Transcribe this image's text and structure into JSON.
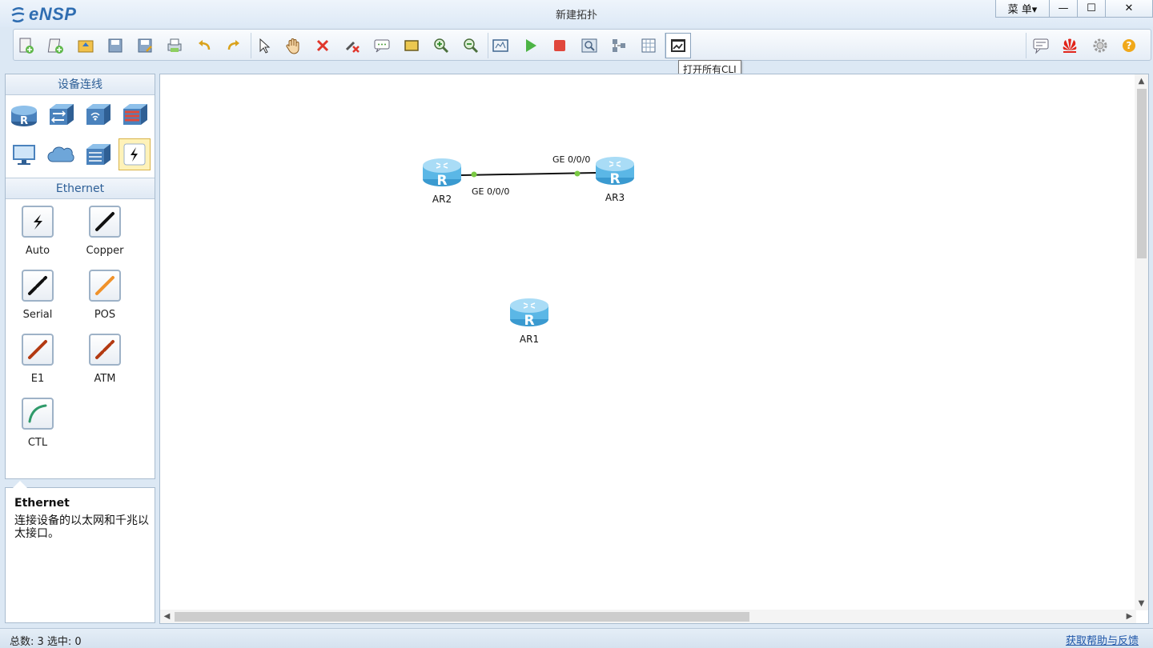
{
  "app": {
    "logo_text": "eNSP",
    "window_title": "新建拓扑",
    "menu_label": "菜 单▾",
    "min_glyph": "—",
    "max_glyph": "☐",
    "close_glyph": "✕"
  },
  "toolbar": {
    "tooltip": "打开所有CLI",
    "left_icons": [
      "new-topology-icon",
      "new-lab-icon",
      "open-icon",
      "save-icon",
      "save-as-icon",
      "print-icon",
      "undo-icon",
      "redo-icon",
      "select-icon",
      "pan-hand-icon",
      "delete-icon",
      "delete-all-links-icon",
      "text-annotation-icon",
      "rectangle-icon",
      "zoom-in-icon",
      "zoom-out-icon",
      "fit-icon",
      "start-device-icon",
      "stop-device-icon",
      "capture-icon",
      "topology-icon",
      "grid-icon",
      "open-cli-icon"
    ],
    "right_icons": [
      "feedback-icon",
      "huawei-icon",
      "settings-icon",
      "help-icon"
    ]
  },
  "left_panel": {
    "devices_title": "设备连线",
    "devices": [
      "router-icon",
      "switch-icon",
      "wireless-icon",
      "firewall-icon",
      "pc-icon",
      "cloud-icon",
      "other-device-icon",
      "connection-icon"
    ],
    "cables_title": "Ethernet",
    "cables": [
      {
        "label": "Auto",
        "icon": "auto-cable-icon",
        "color": "#111111"
      },
      {
        "label": "Copper",
        "icon": "copper-cable-icon",
        "color": "#111111"
      },
      {
        "label": "Serial",
        "icon": "serial-cable-icon",
        "color": "#111111"
      },
      {
        "label": "POS",
        "icon": "pos-cable-icon",
        "color": "#f0922b"
      },
      {
        "label": "E1",
        "icon": "e1-cable-icon",
        "color": "#b33a12"
      },
      {
        "label": "ATM",
        "icon": "atm-cable-icon",
        "color": "#b33a12"
      },
      {
        "label": "CTL",
        "icon": "ctl-cable-icon",
        "color": "#2f9a6a"
      }
    ]
  },
  "description": {
    "title": "Ethernet",
    "text": "连接设备的以太网和千兆以太接口。"
  },
  "canvas": {
    "devices": [
      {
        "name": "AR2"
      },
      {
        "name": "AR3"
      },
      {
        "name": "AR1"
      }
    ],
    "link": {
      "port_a": "GE 0/0/0",
      "port_b": "GE 0/0/0",
      "endpoint_color": "#7ac943"
    }
  },
  "status": {
    "text": "总数:  3  选中:  0",
    "help_link": "获取帮助与反馈"
  }
}
